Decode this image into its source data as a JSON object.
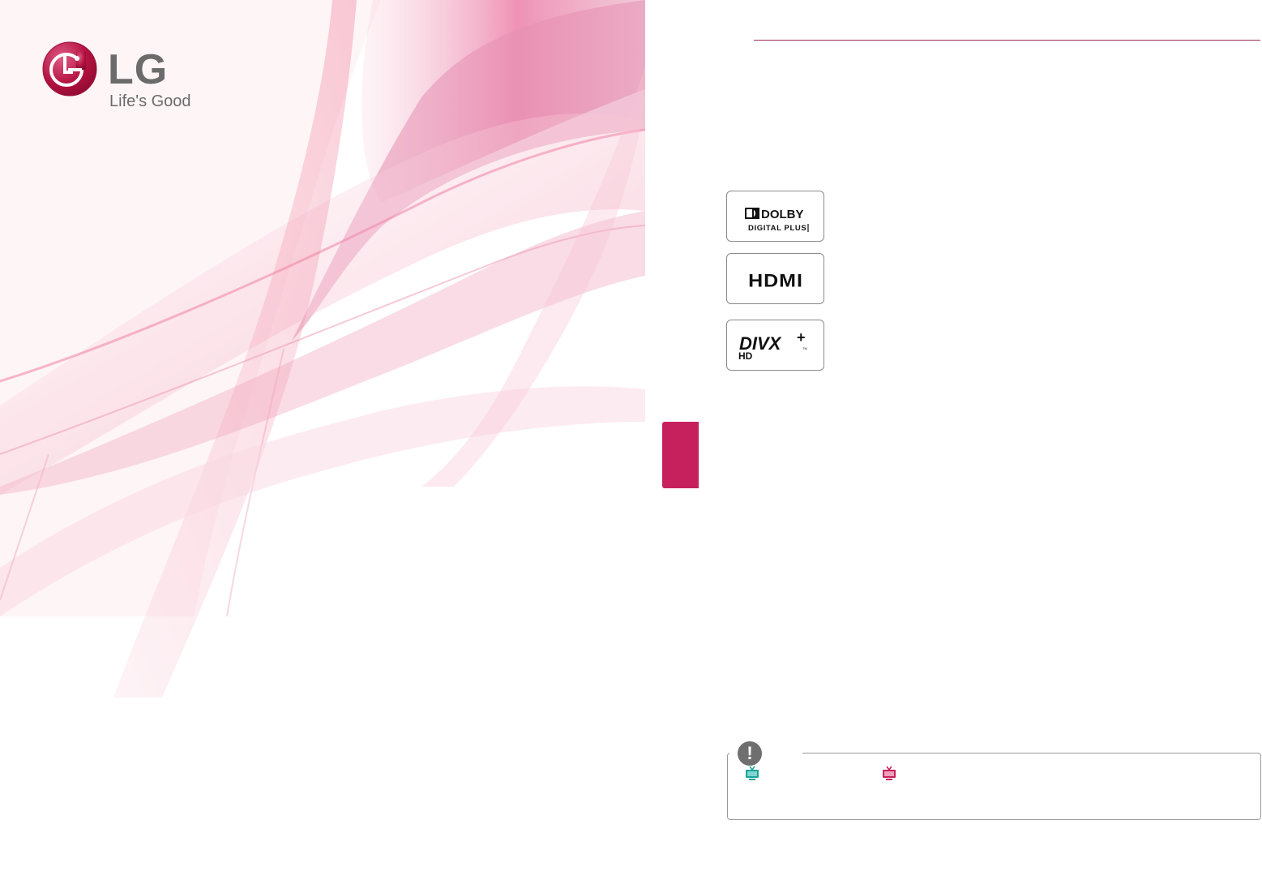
{
  "brand": {
    "wordmark": "LG",
    "tagline": "Life's Good"
  },
  "colors": {
    "brand_pink": "#c7215d",
    "rule": "#9b2c5a",
    "tv_icon_teal": "#1aa39a",
    "tv_icon_pink": "#c7215d"
  },
  "badges": [
    {
      "name": "dolby-digital-plus",
      "line1": "DOLBY",
      "line2": "DIGITAL PLUS"
    },
    {
      "name": "hdmi",
      "line1": "HDMI"
    },
    {
      "name": "divx-plus-hd",
      "line1": "DIVX",
      "line2": "HD"
    }
  ],
  "note": {
    "icon": "exclamation-icon",
    "marker": "!"
  }
}
